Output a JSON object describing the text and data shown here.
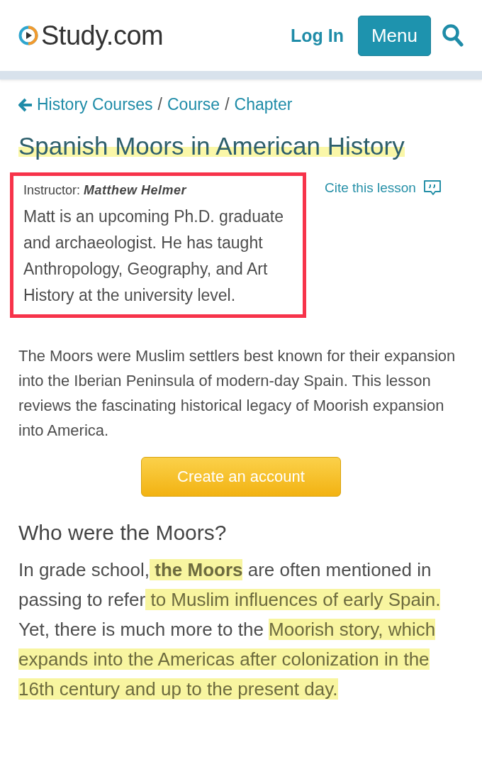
{
  "header": {
    "logo": "Study.com",
    "login": "Log In",
    "menu": "Menu"
  },
  "breadcrumb": [
    {
      "label": "History Courses",
      "kind": "back"
    },
    {
      "separator": "/",
      "label": "Course",
      "kind": "link"
    },
    {
      "separator": "/",
      "label": "Chapter",
      "kind": "link"
    }
  ],
  "title": {
    "text": "Spanish Moors in American History",
    "highlighted": true
  },
  "instructor": {
    "label": "Instructor:",
    "name": "Matthew Helmer",
    "bio": "Matt is an upcoming Ph.D. graduate and archaeologist. He has taught Anthropology, Geography, and Art History at the university level.",
    "outlined": true
  },
  "cite": "Cite this lesson",
  "summary": "The Moors were Muslim settlers best known for their expansion into the Iberian Peninsula of modern-day Spain. This lesson reviews the fascinating historical legacy of Moorish expansion into America.",
  "cta": "Create an account",
  "section": {
    "heading": "Who were the Moors?",
    "segments": [
      {
        "text": "In grade school,",
        "highlighted": false
      },
      {
        "text": " **the Moors**",
        "highlighted": true
      },
      {
        "text": " are often mentioned in passing to refer",
        "highlighted": false
      },
      {
        "text": " to Muslim influences of early Spain.",
        "highlighted": true
      },
      {
        "text": " Yet, there is much more to the ",
        "highlighted": false
      },
      {
        "text": "Moorish story, which expands into the Americas after colonization in the 16th century and up to the present day.",
        "highlighted": true
      }
    ]
  }
}
